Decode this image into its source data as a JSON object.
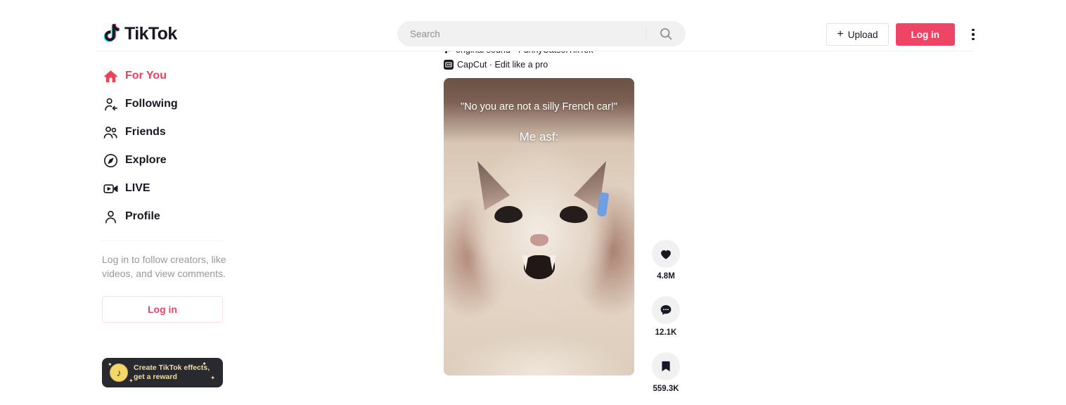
{
  "header": {
    "logo_text": "TikTok",
    "logo_icon": "tiktok-note-icon",
    "search": {
      "value": "",
      "placeholder": "Search",
      "icon": "search-icon"
    },
    "upload_label": "Upload",
    "upload_icon": "plus-icon",
    "login_label": "Log in",
    "more_icon": "more-vertical-icon"
  },
  "sidebar": {
    "items": [
      {
        "label": "For You",
        "icon": "home-icon",
        "active": true
      },
      {
        "label": "Following",
        "icon": "following-icon",
        "active": false
      },
      {
        "label": "Friends",
        "icon": "friends-icon",
        "active": false
      },
      {
        "label": "Explore",
        "icon": "compass-icon",
        "active": false
      },
      {
        "label": "LIVE",
        "icon": "live-icon",
        "active": false
      },
      {
        "label": "Profile",
        "icon": "person-icon",
        "active": false
      }
    ],
    "login_prompt": "Log in to follow creators, like videos, and view comments.",
    "login_button_label": "Log in",
    "effects_banner": {
      "line1": "Create TikTok effects,",
      "line2": "get a reward",
      "icon": "tiktok-coin-icon"
    }
  },
  "feed": {
    "sound_text": "original sound - FunnyCatsofTikTok",
    "sound_icon": "music-note-icon",
    "capcut_text": "CapCut · Edit like a pro",
    "capcut_icon": "capcut-icon",
    "video": {
      "overlay_quote": "\"No you are not a silly French car!\"",
      "overlay_line2": "Me asf:",
      "alt": "close-up of a white cat face being squished by two hands"
    },
    "actions": [
      {
        "icon": "heart-icon",
        "count": "4.8M"
      },
      {
        "icon": "comment-icon",
        "count": "12.1K"
      },
      {
        "icon": "bookmark-icon",
        "count": "559.3K"
      }
    ]
  },
  "colors": {
    "accent_red": "#ee4566",
    "active_red": "#ee4059",
    "text_dark": "#161823",
    "muted": "#98989d",
    "chip_bg": "#f1f1f2",
    "banner_bg": "#292930",
    "banner_gold": "#f0dca4"
  }
}
